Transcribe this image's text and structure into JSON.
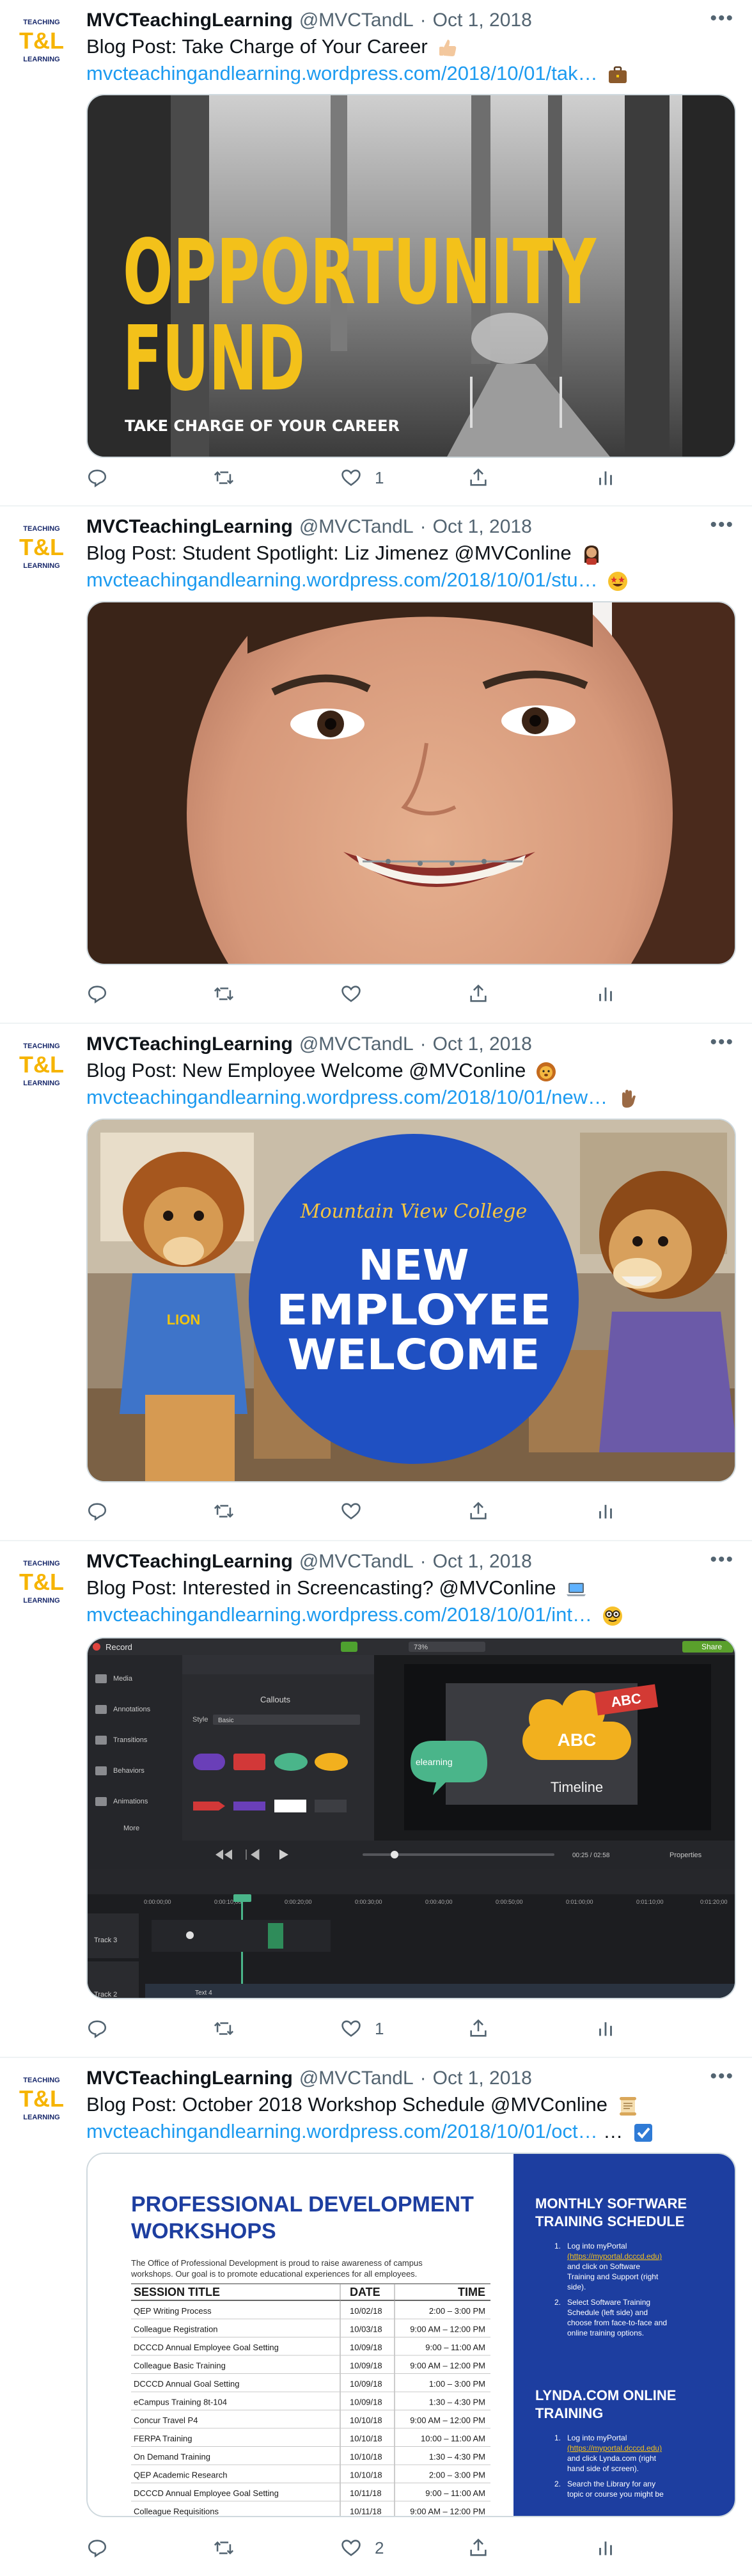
{
  "account": {
    "name": "MVCTeachingLearning",
    "handle": "@MVCTandL",
    "avatar_text": "T&L",
    "avatar_top_text": "TEACHING",
    "avatar_bottom_text": "LEARNING"
  },
  "tweets": [
    {
      "date": "Oct 1, 2018",
      "text": "Blog Post: Take Charge of Your Career",
      "link": "mvcteachingandlearning.wordpress.com/2018/10/01/tak…",
      "emoji1": "thumbs-up-icon",
      "emoji2": "briefcase-icon",
      "media": {
        "title1": "OPPORTUNITY",
        "title2": "FUND",
        "subtitle": "TAKE CHARGE OF YOUR CAREER"
      },
      "likes": "1"
    },
    {
      "date": "Oct 1, 2018",
      "text": "Blog Post: Student Spotlight: Liz Jimenez @MVConline",
      "link": "mvcteachingandlearning.wordpress.com/2018/10/01/stu…",
      "emoji1": "student-icon",
      "emoji2": "star-struck-icon",
      "likes": ""
    },
    {
      "date": "Oct 1, 2018",
      "text": "Blog Post: New Employee Welcome @MVConline",
      "link": "mvcteachingandlearning.wordpress.com/2018/10/01/new…",
      "emoji1": "lion-icon",
      "emoji2": "waving-hand-icon",
      "media": {
        "college": "Mountain View College",
        "line1": "NEW",
        "line2": "EMPLOYEE",
        "line3": "WELCOME"
      },
      "likes": ""
    },
    {
      "date": "Oct 1, 2018",
      "text": "Blog Post: Interested in Screencasting? @MVConline",
      "link": "mvcteachingandlearning.wordpress.com/2018/10/01/int…",
      "emoji1": "laptop-icon",
      "emoji2": "nerd-face-icon",
      "media": {
        "record": "Record",
        "share": "Share",
        "zoom": "73%",
        "callouts": "Callouts",
        "style_label": "Style",
        "style_value": "Basic",
        "sidebar": [
          "Media",
          "Annotations",
          "Transitions",
          "Behaviors",
          "Animations",
          "More"
        ],
        "canvas_abc1": "ABC",
        "canvas_abc2": "ABC",
        "canvas_timeline": "Timeline",
        "canvas_elearning": "elearning",
        "time": "00:25 / 02:58",
        "properties": "Properties",
        "track3": "Track 3",
        "track2": "Track 2",
        "clip_label": "Text 4",
        "ruler": [
          "0:00:00;00",
          "0:00:10;00",
          "0:00:20;00",
          "0:00:30;00",
          "0:00:40;00",
          "0:00:50;00",
          "0:01:00;00",
          "0:01:10;00",
          "0:01:20;00"
        ]
      },
      "likes": "1"
    },
    {
      "date": "Oct 1, 2018",
      "text": "Blog Post: October 2018 Workshop Schedule @MVConline",
      "link": "mvcteachingandlearning.wordpress.com/2018/10/01/oct…",
      "link_suffix": " …",
      "emoji1": "scroll-icon",
      "emoji2": "check-box-icon",
      "media": {
        "heading1": "PROFESSIONAL DEVELOPMENT",
        "heading2": "WORKSHOPS",
        "intro1": "The Office of Professional Development is proud to raise awareness of campus",
        "intro2": "workshops. Our goal is to promote educational experiences for all employees.",
        "columns": [
          "SESSION TITLE",
          "DATE",
          "TIME"
        ],
        "rows": [
          [
            "QEP Writing Process",
            "10/02/18",
            "2:00 – 3:00 PM"
          ],
          [
            "Colleague Registration",
            "10/03/18",
            "9:00 AM – 12:00 PM"
          ],
          [
            "DCCCD Annual Employee Goal Setting",
            "10/09/18",
            "9:00 – 11:00 AM"
          ],
          [
            "Colleague Basic Training",
            "10/09/18",
            "9:00 AM – 12:00 PM"
          ],
          [
            "DCCCD Annual Goal Setting",
            "10/09/18",
            "1:00 – 3:00 PM"
          ],
          [
            "eCampus Training 8t-104",
            "10/09/18",
            "1:30 – 4:30 PM"
          ],
          [
            "Concur Travel P4",
            "10/10/18",
            "9:00 AM – 12:00 PM"
          ],
          [
            "FERPA Training",
            "10/10/18",
            "10:00 – 11:00 AM"
          ],
          [
            "On Demand Training",
            "10/10/18",
            "1:30 – 4:30 PM"
          ],
          [
            "QEP Academic Research",
            "10/10/18",
            "2:00 – 3:00 PM"
          ],
          [
            "DCCCD Annual Employee Goal Setting",
            "10/11/18",
            "9:00 – 11:00 AM"
          ],
          [
            "Colleague Requisitions",
            "10/11/18",
            "9:00 AM – 12:00 PM"
          ]
        ],
        "side_title1a": "MONTHLY SOFTWARE",
        "side_title1b": "TRAINING SCHEDULE",
        "side_items1": [
          [
            "1.",
            "Log into myPortal",
            "(https://myportal.dcccd.edu)",
            "and click on Software",
            "Training and Support (right",
            "side)."
          ],
          [
            "2.",
            "Select Software Training",
            "Schedule (left side) and",
            "choose from face-to-face and",
            "online training options."
          ]
        ],
        "side_title2a": "LYNDA.COM ONLINE",
        "side_title2b": "TRAINING",
        "side_items2": [
          [
            "1.",
            "Log into myPortal",
            "(https://myportal.dcccd.edu)",
            "and click Lynda.com (right",
            "hand side of screen)."
          ],
          [
            "2.",
            "Search the Library for any",
            "topic or course you might be"
          ]
        ]
      },
      "likes": "2"
    }
  ]
}
